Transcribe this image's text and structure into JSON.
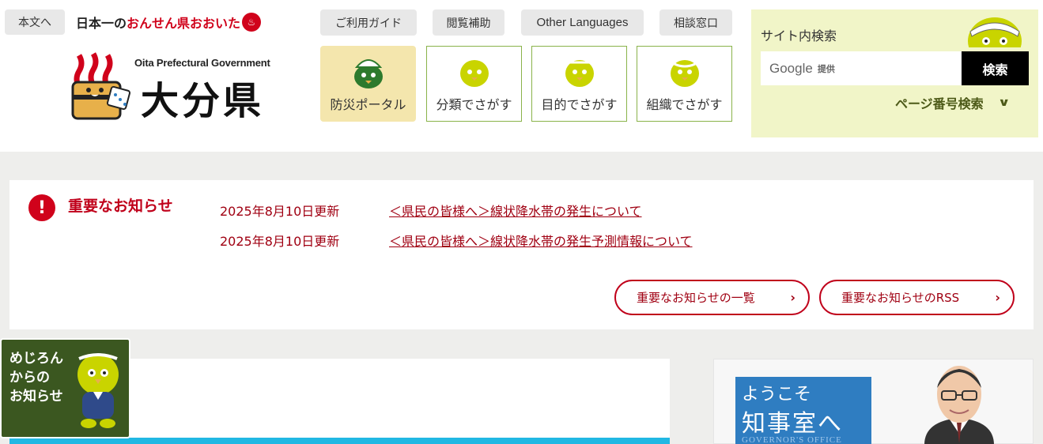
{
  "header": {
    "skip_link": "本文へ",
    "slogan_prefix": "日本一の",
    "slogan_highlight": "おんせん県おおいた",
    "logo_en": "Oita Prefectural Government",
    "logo_ja": "大分県",
    "utility_links": [
      "ご利用ガイド",
      "閲覧補助",
      "Other Languages",
      "相談窓口"
    ],
    "nav_tiles": [
      "防災ポータル",
      "分類でさがす",
      "目的でさがす",
      "組織でさがす"
    ]
  },
  "search": {
    "title": "サイト内検索",
    "google_label": "Google",
    "google_sub": "提供",
    "button_label": "検索",
    "page_number_search": "ページ番号検索"
  },
  "notice": {
    "title": "重要なお知らせ",
    "items": [
      {
        "date": "2025年8月10日更新",
        "text": "＜県民の皆様へ＞線状降水帯の発生について"
      },
      {
        "date": "2025年8月10日更新",
        "text": "＜県民の皆様へ＞線状降水帯の発生予測情報について"
      }
    ],
    "list_button": "重要なお知らせの一覧",
    "rss_button": "重要なお知らせのRSS"
  },
  "mejiron": {
    "line1": "めじろん",
    "line2": "からの",
    "line3": "お知らせ"
  },
  "governor": {
    "line1": "ようこそ",
    "line2": "知事室へ",
    "line3": "GOVERNOR'S OFFICE"
  },
  "colors": {
    "accent_red": "#c0001a",
    "panel_green": "#f1f5c8",
    "mascot_green": "#c9d400",
    "governor_blue": "#2f7dc1"
  }
}
